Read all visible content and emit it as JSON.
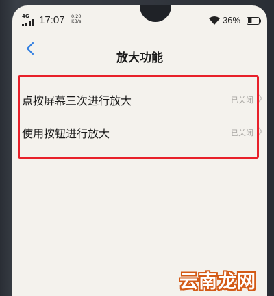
{
  "status_bar": {
    "network": "4G",
    "time": "17:07",
    "speed_value": "0.20",
    "speed_unit": "KB/s",
    "battery_percent": "36%",
    "battery_level": 0.36
  },
  "header": {
    "title": "放大功能",
    "back_icon": "chevron-left-icon"
  },
  "settings": [
    {
      "label": "点按屏幕三次进行放大",
      "status": "已关闭"
    },
    {
      "label": "使用按钮进行放大",
      "status": "已关闭"
    }
  ],
  "highlight": {
    "color": "#e8202a"
  },
  "watermark": {
    "text": "云南龙网",
    "color": "#d35a16"
  },
  "colors": {
    "accent": "#2f7de1",
    "screen_bg": "#f4f2ed"
  }
}
